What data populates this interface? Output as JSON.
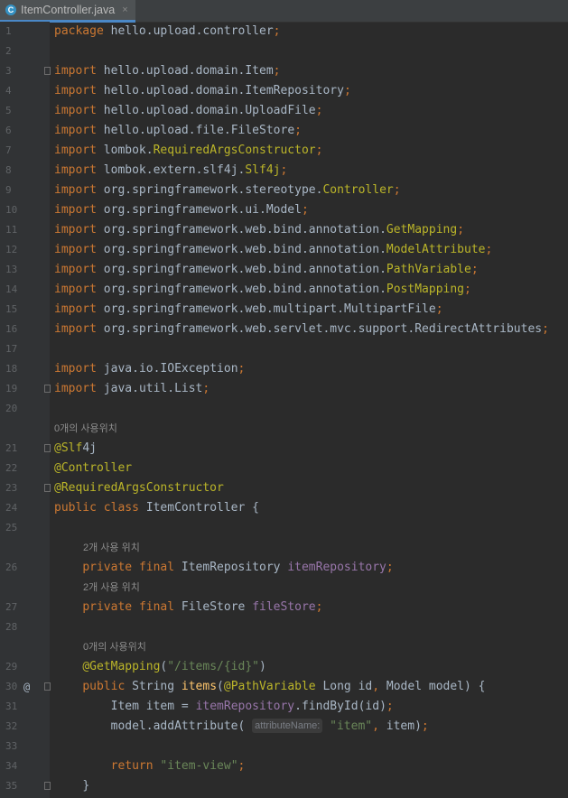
{
  "tab": {
    "icon_letter": "C",
    "file": "ItemController.java",
    "close": "×"
  },
  "lines": [
    {
      "n": "1",
      "t": "package hello.upload.controller;"
    },
    {
      "n": "2",
      "t": ""
    },
    {
      "n": "3",
      "t": "import hello.upload.domain.Item;"
    },
    {
      "n": "4",
      "t": "import hello.upload.domain.ItemRepository;"
    },
    {
      "n": "5",
      "t": "import hello.upload.domain.UploadFile;"
    },
    {
      "n": "6",
      "t": "import hello.upload.file.FileStore;"
    },
    {
      "n": "7",
      "t": "import lombok.RequiredArgsConstructor;"
    },
    {
      "n": "8",
      "t": "import lombok.extern.slf4j.Slf4j;"
    },
    {
      "n": "9",
      "t": "import org.springframework.stereotype.Controller;"
    },
    {
      "n": "10",
      "t": "import org.springframework.ui.Model;"
    },
    {
      "n": "11",
      "t": "import org.springframework.web.bind.annotation.GetMapping;"
    },
    {
      "n": "12",
      "t": "import org.springframework.web.bind.annotation.ModelAttribute;"
    },
    {
      "n": "13",
      "t": "import org.springframework.web.bind.annotation.PathVariable;"
    },
    {
      "n": "14",
      "t": "import org.springframework.web.bind.annotation.PostMapping;"
    },
    {
      "n": "15",
      "t": "import org.springframework.web.multipart.MultipartFile;"
    },
    {
      "n": "16",
      "t": "import org.springframework.web.servlet.mvc.support.RedirectAttributes;"
    },
    {
      "n": "17",
      "t": ""
    },
    {
      "n": "18",
      "t": "import java.io.IOException;"
    },
    {
      "n": "19",
      "t": "import java.util.List;"
    },
    {
      "n": "20",
      "t": ""
    },
    {
      "n": "21",
      "t": "@Slf4j"
    },
    {
      "n": "22",
      "t": "@Controller"
    },
    {
      "n": "23",
      "t": "@RequiredArgsConstructor"
    },
    {
      "n": "24",
      "t": "public class ItemController {"
    },
    {
      "n": "25",
      "t": ""
    },
    {
      "n": "26",
      "t": "    private final ItemRepository itemRepository;"
    },
    {
      "n": "27",
      "t": "    private final FileStore fileStore;"
    },
    {
      "n": "28",
      "t": ""
    },
    {
      "n": "29",
      "t": "    @GetMapping(\"/items/{id}\")"
    },
    {
      "n": "30",
      "t": "    public String items(@PathVariable Long id, Model model) {"
    },
    {
      "n": "31",
      "t": "        Item item = itemRepository.findById(id);"
    },
    {
      "n": "32",
      "t": "        model.addAttribute( attributeName: \"item\", item);"
    },
    {
      "n": "33",
      "t": ""
    },
    {
      "n": "34",
      "t": "        return \"item-view\";"
    },
    {
      "n": "35",
      "t": "    }"
    }
  ],
  "usage_hints": {
    "class_usages": "0개의 사용위치",
    "repo_usages": "2개 사용 위치",
    "filestore_usages": "2개 사용 위치",
    "method_usages": "0개의 사용위치"
  },
  "gutter_marker": "@",
  "inlay_hint": "attributeName:",
  "colors": {
    "background": "#2b2b2b",
    "gutter": "#313335",
    "keyword": "#cc7832",
    "annotation": "#bbb529",
    "string": "#6a8759",
    "field": "#9876aa",
    "method": "#ffc66d",
    "text": "#a9b7c6",
    "hint": "#8c8c8c"
  }
}
